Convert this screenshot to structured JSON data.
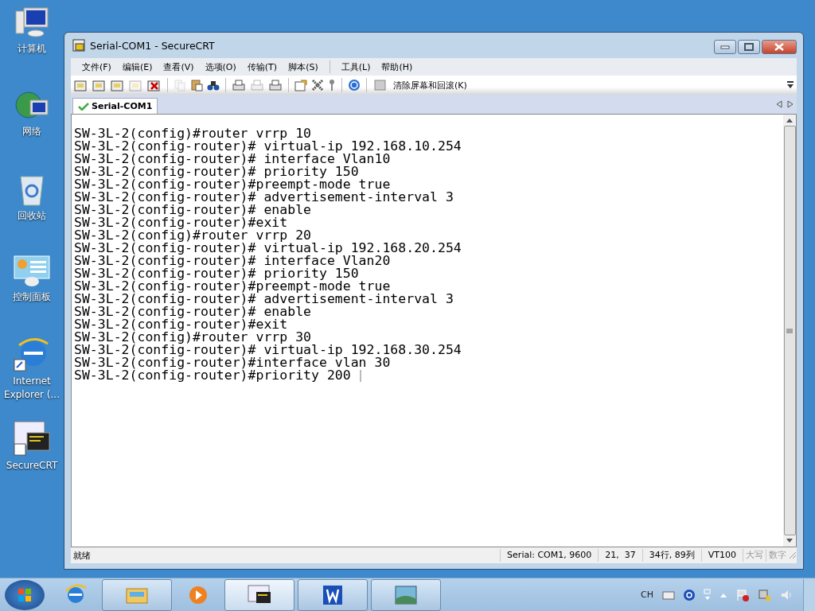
{
  "desktop_icons": [
    {
      "kind": "computer",
      "label": "计算机"
    },
    {
      "kind": "network",
      "label": "网络"
    },
    {
      "kind": "recycle-bin",
      "label": "回收站"
    },
    {
      "kind": "control-panel",
      "label": "控制面板"
    },
    {
      "kind": "browser",
      "label": "Internet Explorer (..."
    },
    {
      "kind": "terminal",
      "label": "SecureCRT"
    }
  ],
  "window": {
    "title": "Serial-COM1 - SecureCRT",
    "menu": [
      "文件(F)",
      "编辑(E)",
      "查看(V)",
      "选项(O)",
      "传输(T)",
      "脚本(S)",
      "工具(L)",
      "帮助(H)"
    ],
    "toolbar": {
      "clear_button": "清除屏幕和回滚(K)"
    },
    "tabs": [
      {
        "label": "Serial-COM1",
        "selected": true
      }
    ],
    "terminal_lines": [
      "SW-3L-2(config)#router vrrp 10",
      "SW-3L-2(config-router)# virtual-ip 192.168.10.254",
      "SW-3L-2(config-router)# interface Vlan10",
      "SW-3L-2(config-router)# priority 150",
      "SW-3L-2(config-router)#preempt-mode true",
      "SW-3L-2(config-router)# advertisement-interval 3",
      "SW-3L-2(config-router)# enable",
      "SW-3L-2(config-router)#exit",
      "SW-3L-2(config)#router vrrp 20",
      "SW-3L-2(config-router)# virtual-ip 192.168.20.254",
      "SW-3L-2(config-router)# interface Vlan20",
      "SW-3L-2(config-router)# priority 150",
      "SW-3L-2(config-router)#preempt-mode true",
      "SW-3L-2(config-router)# advertisement-interval 3",
      "SW-3L-2(config-router)# enable",
      "SW-3L-2(config-router)#exit",
      "SW-3L-2(config)#router vrrp 30",
      "SW-3L-2(config-router)# virtual-ip 192.168.30.254",
      "SW-3L-2(config-router)#interface vlan 30",
      "SW-3L-2(config-router)#priority 200"
    ],
    "status_bar": {
      "message": "就绪",
      "fields": [
        "Serial: COM1, 9600",
        "21,  37",
        "34行, 89列",
        "VT100"
      ],
      "indicators": [
        {
          "label": "大写",
          "disabled": true
        },
        {
          "label": "数字",
          "disabled": true
        }
      ]
    }
  },
  "taskbar": {
    "apps": [
      {
        "kind": "browser",
        "open": false,
        "selected": false
      },
      {
        "kind": "folder",
        "open": true,
        "selected": false
      },
      {
        "kind": "media",
        "open": false,
        "selected": false
      },
      {
        "kind": "terminal",
        "open": true,
        "selected": true
      },
      {
        "kind": "document",
        "open": true,
        "selected": false
      },
      {
        "kind": "picture",
        "open": true,
        "selected": false
      }
    ],
    "language": "CH"
  }
}
